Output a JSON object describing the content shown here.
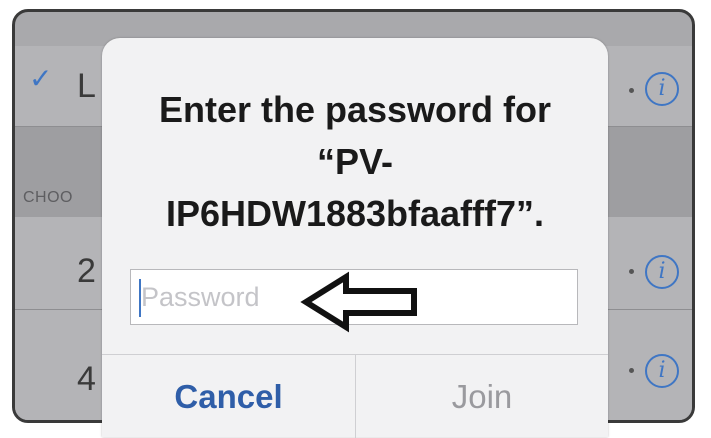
{
  "background": {
    "network_row_1": {
      "label_fragment": "L"
    },
    "section_header": {
      "label_fragment": "CHOO"
    },
    "network_row_2": {
      "label_fragment": "2"
    },
    "network_row_3": {
      "label_fragment": "4"
    },
    "info_glyph": "i"
  },
  "dialog": {
    "title_line_1": "Enter the password for",
    "title_line_2": "“PV-",
    "title_line_3": "IP6HDW1883bfaafff7”.",
    "password_placeholder": "Password",
    "password_value": "",
    "cancel_label": "Cancel",
    "join_label": "Join"
  },
  "colors": {
    "accent": "#3f76c4",
    "cancel_text": "#2f5ea8",
    "join_disabled_text": "#9a9a9e",
    "arrow_stroke": "#111111"
  }
}
